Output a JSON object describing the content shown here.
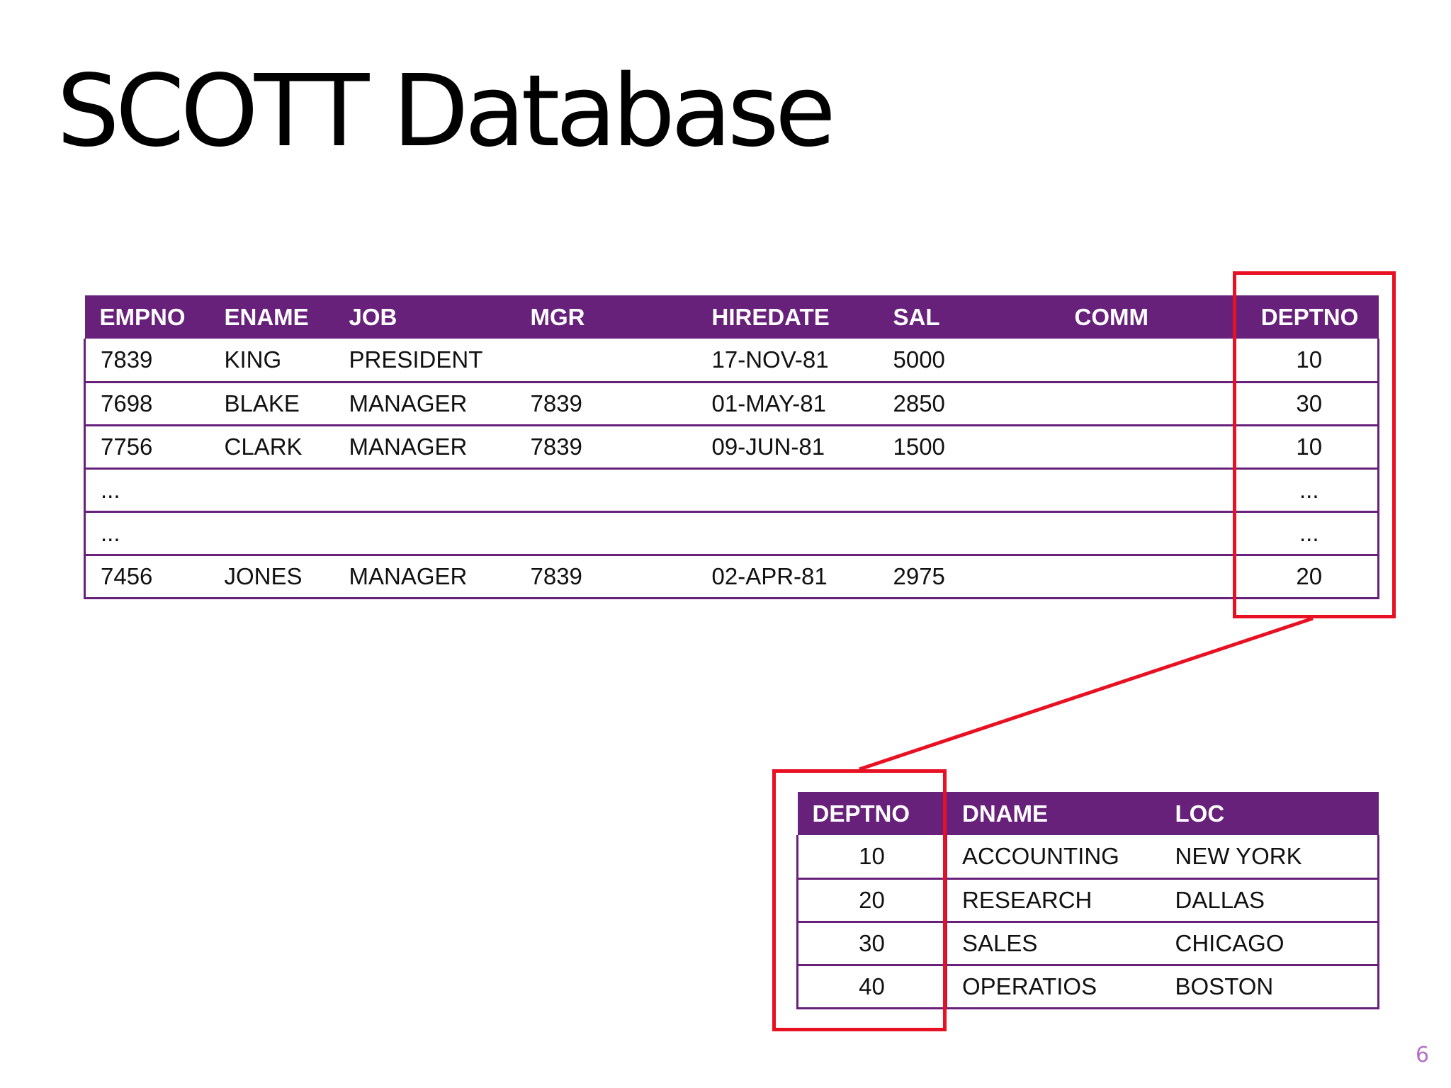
{
  "slide": {
    "title": "SCOTT Database",
    "page_number": "6"
  },
  "colors": {
    "header_background": "#68217a",
    "header_text": "#ffffff",
    "row_border": "#68217a",
    "highlight": "#e81123",
    "page_number": "#b56fc7"
  },
  "emp_table": {
    "headers": [
      "EMPNO",
      "ENAME",
      "JOB",
      "MGR",
      "HIREDATE",
      "SAL",
      "COMM",
      "DEPTNO"
    ],
    "rows": [
      [
        "7839",
        "KING",
        "PRESIDENT",
        "",
        "17-NOV-81",
        "5000",
        "",
        "10"
      ],
      [
        "7698",
        "BLAKE",
        "MANAGER",
        "7839",
        "01-MAY-81",
        "2850",
        "",
        "30"
      ],
      [
        "7756",
        "CLARK",
        "MANAGER",
        "7839",
        "09-JUN-81",
        "1500",
        "",
        "10"
      ],
      [
        "...",
        "",
        "",
        "",
        "",
        "",
        "",
        "..."
      ],
      [
        "...",
        "",
        "",
        "",
        "",
        "",
        "",
        "..."
      ],
      [
        "7456",
        "JONES",
        "MANAGER",
        "7839",
        "02-APR-81",
        "2975",
        "",
        "20"
      ]
    ]
  },
  "dept_table": {
    "headers": [
      "DEPTNO",
      "DNAME",
      "LOC"
    ],
    "rows": [
      [
        "10",
        "ACCOUNTING",
        "NEW YORK"
      ],
      [
        "20",
        "RESEARCH",
        "DALLAS"
      ],
      [
        "30",
        "SALES",
        "CHICAGO"
      ],
      [
        "40",
        "OPERATIOS",
        "BOSTON"
      ]
    ]
  }
}
